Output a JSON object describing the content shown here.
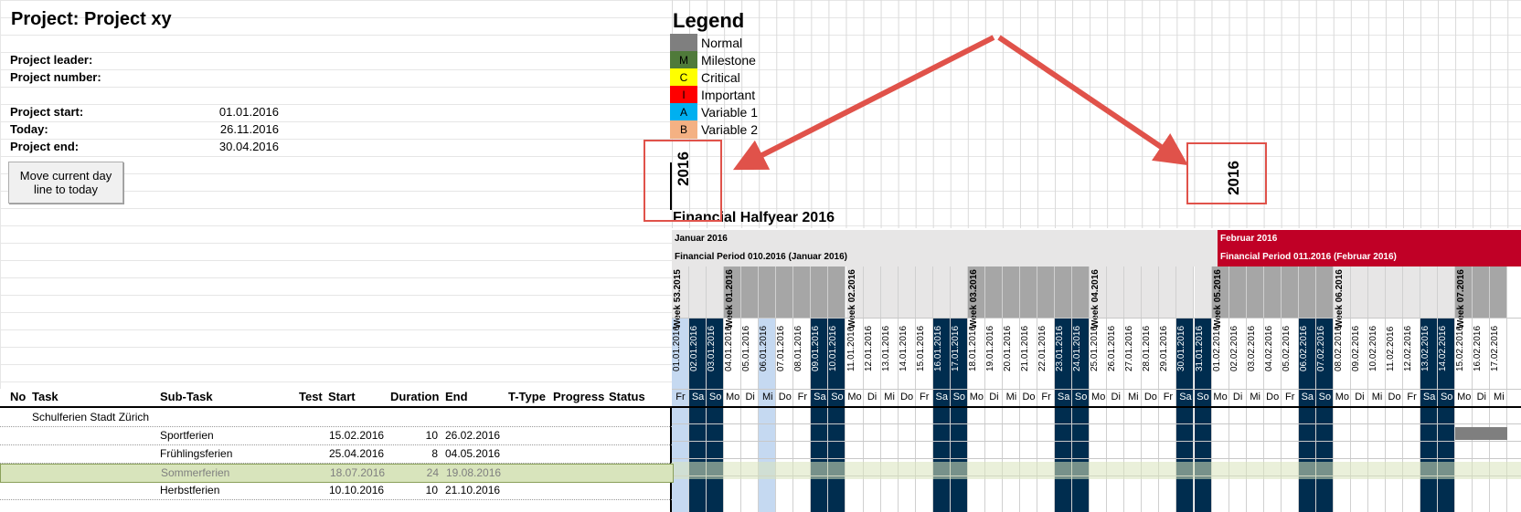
{
  "project": {
    "title": "Project: Project xy",
    "leader_label": "Project leader:",
    "number_label": "Project number:",
    "start_label": "Project start:",
    "start_value": "01.01.2016",
    "today_label": "Today:",
    "today_value": "26.11.2016",
    "end_label": "Project end:",
    "end_value": "30.04.2016",
    "move_button": "Move current day line to today"
  },
  "legend": {
    "title": "Legend",
    "items": [
      {
        "code": "",
        "label": "Normal",
        "color": "#7f7f7f"
      },
      {
        "code": "M",
        "label": "Milestone",
        "color": "#4f7a3a"
      },
      {
        "code": "C",
        "label": "Critical",
        "color": "#ffff00"
      },
      {
        "code": "I",
        "label": "Important",
        "color": "#ff0000"
      },
      {
        "code": "A",
        "label": "Variable 1",
        "color": "#00b0f0"
      },
      {
        "code": "B",
        "label": "Variable 2",
        "color": "#f4b183"
      }
    ]
  },
  "year_labels": [
    "2016",
    "2016"
  ],
  "financial_halfyear": "Financial Halfyear 2016",
  "months": [
    {
      "name": "Januar 2016",
      "period": "Financial Period 010.2016 (Januar 2016)",
      "bg": "#e7e6e6",
      "fg": "#000000"
    },
    {
      "name": "Februar 2016",
      "period": "Financial Period 011.2016 (Februar 2016)",
      "bg": "#c00026",
      "fg": "#ffffff"
    }
  ],
  "weeks": [
    "Week 53.2015",
    "Week 01.2016",
    "Week 02.2016",
    "Week 03.2016",
    "Week 04.2016",
    "Week 05.2016",
    "Week 06.2016",
    "Week 07.2016"
  ],
  "days": [
    {
      "date": "01.01.2016",
      "day": "Fr"
    },
    {
      "date": "02.01.2016",
      "day": "Sa"
    },
    {
      "date": "03.01.2016",
      "day": "So"
    },
    {
      "date": "04.01.2016",
      "day": "Mo"
    },
    {
      "date": "05.01.2016",
      "day": "Di"
    },
    {
      "date": "06.01.2016",
      "day": "Mi"
    },
    {
      "date": "07.01.2016",
      "day": "Do"
    },
    {
      "date": "08.01.2016",
      "day": "Fr"
    },
    {
      "date": "09.01.2016",
      "day": "Sa"
    },
    {
      "date": "10.01.2016",
      "day": "So"
    },
    {
      "date": "11.01.2016",
      "day": "Mo"
    },
    {
      "date": "12.01.2016",
      "day": "Di"
    },
    {
      "date": "13.01.2016",
      "day": "Mi"
    },
    {
      "date": "14.01.2016",
      "day": "Do"
    },
    {
      "date": "15.01.2016",
      "day": "Fr"
    },
    {
      "date": "16.01.2016",
      "day": "Sa"
    },
    {
      "date": "17.01.2016",
      "day": "So"
    },
    {
      "date": "18.01.2016",
      "day": "Mo"
    },
    {
      "date": "19.01.2016",
      "day": "Di"
    },
    {
      "date": "20.01.2016",
      "day": "Mi"
    },
    {
      "date": "21.01.2016",
      "day": "Do"
    },
    {
      "date": "22.01.2016",
      "day": "Fr"
    },
    {
      "date": "23.01.2016",
      "day": "Sa"
    },
    {
      "date": "24.01.2016",
      "day": "So"
    },
    {
      "date": "25.01.2016",
      "day": "Mo"
    },
    {
      "date": "26.01.2016",
      "day": "Di"
    },
    {
      "date": "27.01.2016",
      "day": "Mi"
    },
    {
      "date": "28.01.2016",
      "day": "Do"
    },
    {
      "date": "29.01.2016",
      "day": "Fr"
    },
    {
      "date": "30.01.2016",
      "day": "Sa"
    },
    {
      "date": "31.01.2016",
      "day": "So"
    },
    {
      "date": "01.02.2016",
      "day": "Mo"
    },
    {
      "date": "02.02.2016",
      "day": "Di"
    },
    {
      "date": "03.02.2016",
      "day": "Mi"
    },
    {
      "date": "04.02.2016",
      "day": "Do"
    },
    {
      "date": "05.02.2016",
      "day": "Fr"
    },
    {
      "date": "06.02.2016",
      "day": "Sa"
    },
    {
      "date": "07.02.2016",
      "day": "So"
    },
    {
      "date": "08.02.2016",
      "day": "Mo"
    },
    {
      "date": "09.02.2016",
      "day": "Di"
    },
    {
      "date": "10.02.2016",
      "day": "Mi"
    },
    {
      "date": "11.02.2016",
      "day": "Do"
    },
    {
      "date": "12.02.2016",
      "day": "Fr"
    },
    {
      "date": "13.02.2016",
      "day": "Sa"
    },
    {
      "date": "14.02.2016",
      "day": "So"
    },
    {
      "date": "15.02.2016",
      "day": "Mo"
    },
    {
      "date": "16.02.2016",
      "day": "Di"
    },
    {
      "date": "17.02.2016",
      "day": "Mi"
    }
  ],
  "table": {
    "headers": [
      "No",
      "Task",
      "Sub-Task",
      "Test",
      "Start",
      "Duration",
      "End",
      "T-Type",
      "Progress",
      "Status"
    ],
    "rows": [
      {
        "task": "Schulferien Stadt Zürich",
        "subtask": "",
        "start": "",
        "duration": "",
        "end": "",
        "highlight": false
      },
      {
        "task": "",
        "subtask": "Sportferien",
        "start": "15.02.2016",
        "duration": "10",
        "end": "26.02.2016",
        "highlight": false
      },
      {
        "task": "",
        "subtask": "Frühlingsferien",
        "start": "25.04.2016",
        "duration": "8",
        "end": "04.05.2016",
        "highlight": false
      },
      {
        "task": "",
        "subtask": "Sommerferien",
        "start": "18.07.2016",
        "duration": "24",
        "end": "19.08.2016",
        "highlight": true
      },
      {
        "task": "",
        "subtask": "Herbstferien",
        "start": "10.10.2016",
        "duration": "10",
        "end": "21.10.2016",
        "highlight": false
      }
    ]
  },
  "colors": {
    "weekend": "#002d4f",
    "week_shade": "#a6a6a6",
    "header_bg": "#e7e6e6",
    "today_col": "#c5d9f1",
    "highlight_row": "#d8e4bc",
    "arrow": "#e0524a"
  }
}
